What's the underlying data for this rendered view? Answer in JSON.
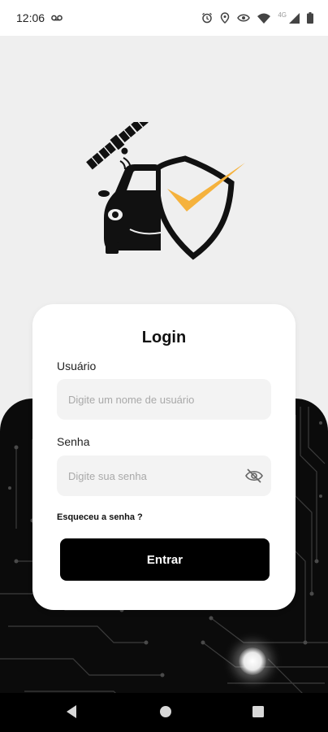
{
  "status_bar": {
    "time": "12:06",
    "voicemail_icon": "voicemail-icon",
    "network_label": "4G",
    "icons": [
      "alarm-icon",
      "location-icon",
      "eye-icon",
      "wifi-icon",
      "signal-icon",
      "battery-icon"
    ]
  },
  "logo": {
    "description_icon": "car-satellite-shield-check-logo",
    "accent_color": "#f5b23d"
  },
  "login": {
    "title": "Login",
    "username_label": "Usuário",
    "username_placeholder": "Digite um nome de usuário",
    "username_value": "",
    "password_label": "Senha",
    "password_placeholder": "Digite sua senha",
    "password_value": "",
    "password_toggle_icon": "eye-off-icon",
    "forgot_password": "Esqueceu a senha ?",
    "submit_label": "Entrar"
  },
  "navigation": {
    "back_icon": "back-triangle-icon",
    "home_icon": "home-circle-icon",
    "recents_icon": "recents-square-icon"
  },
  "colors": {
    "background": "#efefef",
    "card": "#ffffff",
    "primary_button": "#000000",
    "accent": "#f5b23d"
  }
}
